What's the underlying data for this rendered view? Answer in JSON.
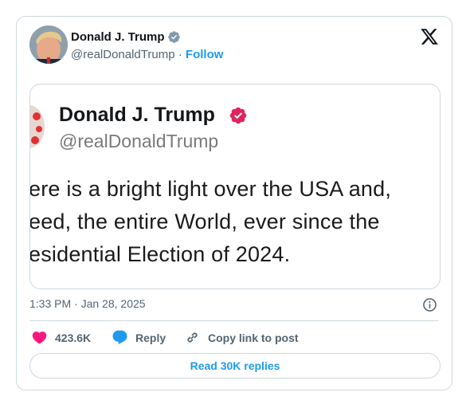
{
  "author": {
    "name": "Donald J. Trump",
    "handle": "@realDonaldTrump",
    "separator": "·",
    "follow_label": "Follow"
  },
  "embedded_post": {
    "name": "Donald J. Trump",
    "handle": "@realDonaldTrump",
    "lines": [
      "ere is a bright light over the USA and,",
      "eed, the entire World, ever since the",
      "esidential Election of 2024."
    ]
  },
  "meta": {
    "time": "1:33 PM",
    "separator": "·",
    "date": "Jan 28, 2025"
  },
  "actions": {
    "like_count": "423.6K",
    "reply_label": "Reply",
    "copy_label": "Copy link to post"
  },
  "read_replies_label": "Read 30K replies",
  "colors": {
    "accent": "#1d9bf0",
    "like": "#f91880",
    "verified_small": "#829aab",
    "verified_big": "#e0245e",
    "border": "#cfd9de",
    "muted": "#536471"
  },
  "icons": [
    "x-logo-icon",
    "verified-icon",
    "info-icon",
    "heart-icon",
    "reply-bubble-icon",
    "link-icon"
  ]
}
